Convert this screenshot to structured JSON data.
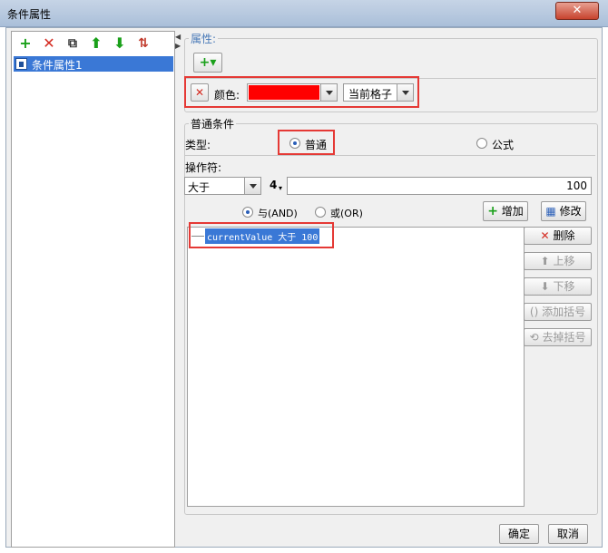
{
  "window": {
    "title": "条件属性",
    "close_label": "✕"
  },
  "left": {
    "tree_item": "条件属性1",
    "toolbar": {
      "add": "+",
      "delete": "✕",
      "copy": "⧉",
      "up": "⬆",
      "down": "⬇",
      "sort": "⇅"
    }
  },
  "properties": {
    "legend": "属性:",
    "add_button": "+▾",
    "color_label": "颜色:",
    "color_value": "#ff0000",
    "scope_value": "当前格子"
  },
  "condition": {
    "legend": "普通条件",
    "type_label": "类型:",
    "type_normal": "普通",
    "type_formula": "公式",
    "operator_label": "操作符:",
    "operator_value": "大于",
    "value_type": "4",
    "value": "100",
    "logic_and": "与(AND)",
    "logic_or": "或(OR)",
    "add_label": "增加",
    "modify_label": "修改",
    "list_item": "currentValue 大于 100",
    "delete_label": "删除",
    "up_label": "上移",
    "down_label": "下移",
    "add_bracket_label": "添加括号",
    "remove_bracket_label": "去掉括号"
  },
  "footer": {
    "ok": "确定",
    "cancel": "取消"
  }
}
